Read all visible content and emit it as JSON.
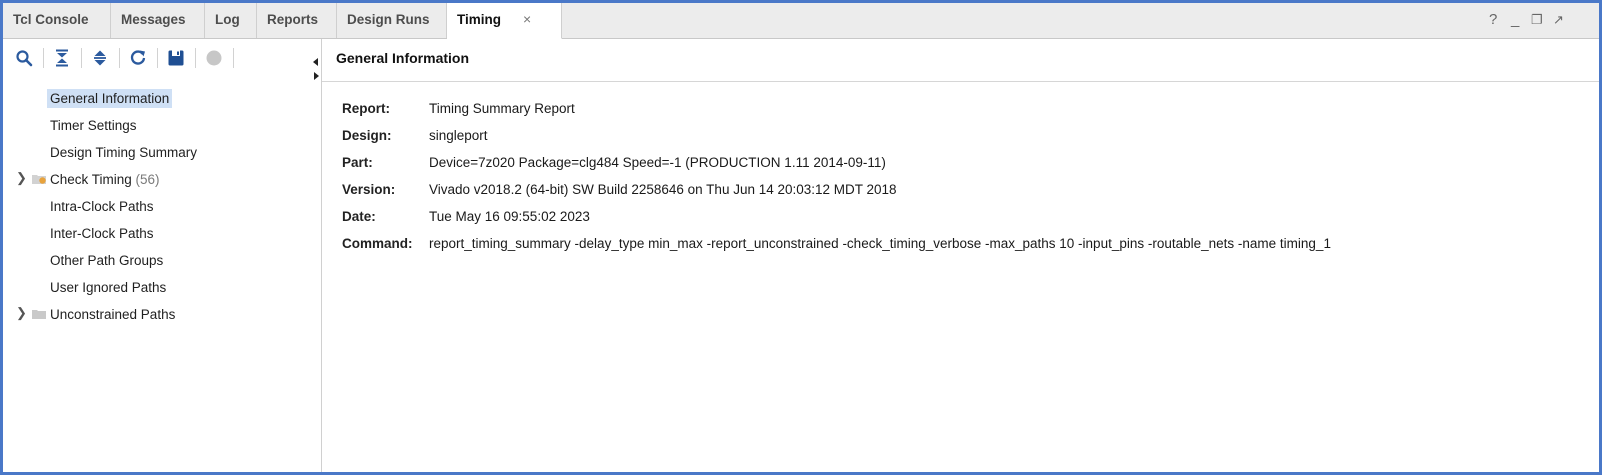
{
  "tabs": [
    {
      "label": "Tcl Console"
    },
    {
      "label": "Messages"
    },
    {
      "label": "Log"
    },
    {
      "label": "Reports"
    },
    {
      "label": "Design Runs"
    },
    {
      "label": "Timing",
      "active": true
    }
  ],
  "tab_close_glyph": "×",
  "window_controls": {
    "help": "?",
    "minimize": "_",
    "restore": "❐",
    "float": "↗"
  },
  "toolbar_icons": [
    "search-icon",
    "collapse-all-icon",
    "expand-all-icon",
    "refresh-icon",
    "save-icon",
    "stop-icon"
  ],
  "tree": {
    "items": [
      {
        "label": "General Information",
        "selected": true
      },
      {
        "label": "Timer Settings"
      },
      {
        "label": "Design Timing Summary"
      },
      {
        "label": "Check Timing",
        "count": "(56)",
        "expandable": true,
        "folder_color": "#e8a33d"
      },
      {
        "label": "Intra-Clock Paths"
      },
      {
        "label": "Inter-Clock Paths"
      },
      {
        "label": "Other Path Groups"
      },
      {
        "label": "User Ignored Paths"
      },
      {
        "label": "Unconstrained Paths",
        "expandable": true,
        "folder_color": "#b8b8b8"
      }
    ]
  },
  "panel": {
    "title": "General Information",
    "rows": [
      {
        "key": "Report:",
        "value": "Timing Summary Report"
      },
      {
        "key": "Design:",
        "value": "singleport"
      },
      {
        "key": "Part:",
        "value": "Device=7z020 Package=clg484 Speed=-1 (PRODUCTION 1.11 2014-09-11)"
      },
      {
        "key": "Version:",
        "value": "Vivado v2018.2 (64-bit) SW Build 2258646 on Thu Jun 14 20:03:12 MDT 2018"
      },
      {
        "key": "Date:",
        "value": "Tue May 16 09:55:02 2023"
      },
      {
        "key": "Command:",
        "value": "report_timing_summary -delay_type min_max -report_unconstrained -check_timing_verbose -max_paths 10 -input_pins -routable_nets -name timing_1"
      }
    ]
  },
  "colors": {
    "accent": "#4a78c8",
    "selection": "#cfe0f5",
    "icon": "#2b5a9e"
  }
}
